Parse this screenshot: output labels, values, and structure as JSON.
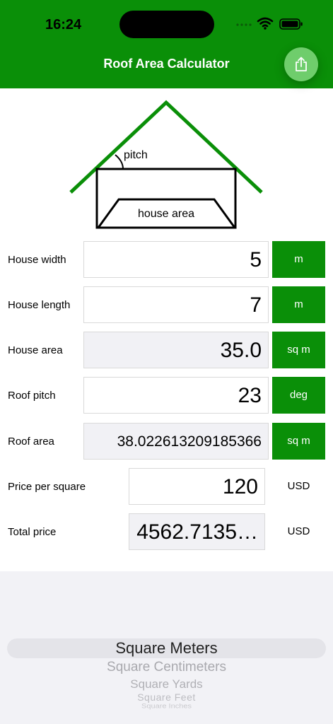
{
  "status_bar": {
    "time": "16:24"
  },
  "nav": {
    "title": "Roof Area Calculator"
  },
  "diagram": {
    "pitch_label": "pitch",
    "house_area_label": "house area"
  },
  "rows": [
    {
      "label": "House width",
      "value": "5",
      "unit": "m"
    },
    {
      "label": "House length",
      "value": "7",
      "unit": "m"
    },
    {
      "label": "House area",
      "value": "35.0",
      "unit": "sq m"
    },
    {
      "label": "Roof pitch",
      "value": "23",
      "unit": "deg"
    },
    {
      "label": "Roof area",
      "value": "38.022613209185366",
      "unit": "sq m"
    },
    {
      "label": "Price per square",
      "value": "120",
      "unit": "USD"
    },
    {
      "label": "Total price",
      "value": "4562.7135…",
      "unit": "USD"
    }
  ],
  "picker": {
    "selected": "Square Meters",
    "options": [
      "Square Centimeters",
      "Square Yards",
      "Square Feet",
      "Square Inches"
    ]
  },
  "colors": {
    "accent": "#0a8f08",
    "share_button": "#6fcd6c"
  }
}
